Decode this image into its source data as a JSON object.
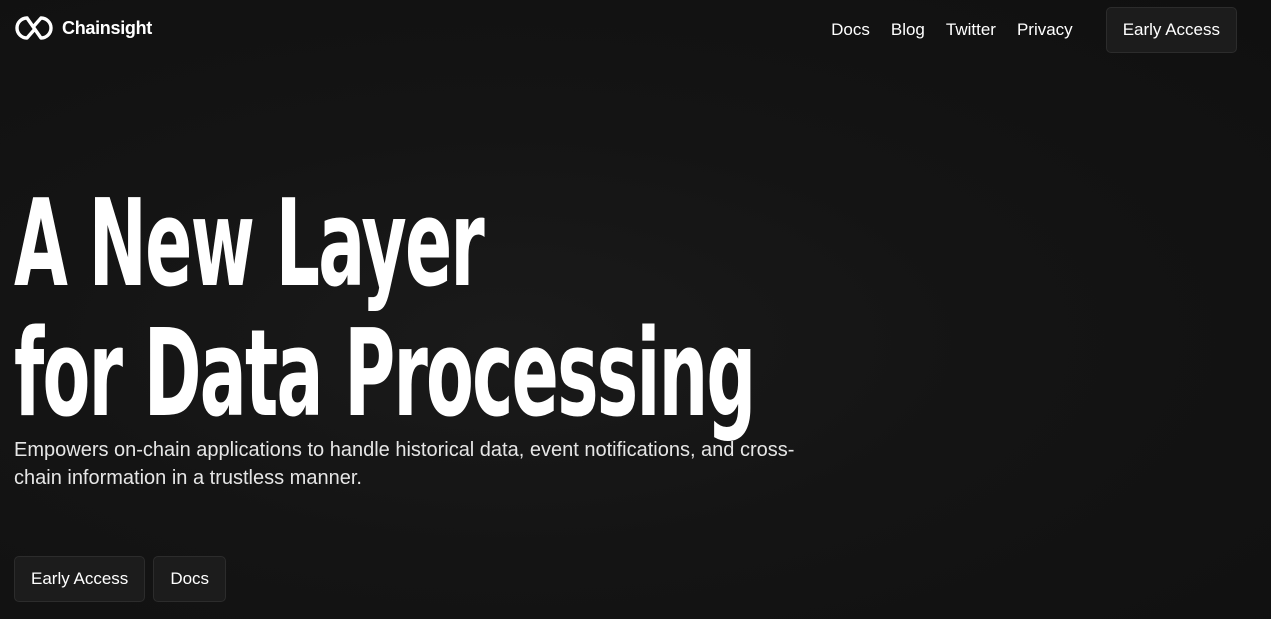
{
  "brand": {
    "name": "Chainsight",
    "logo_icon": "interlocked-rings-icon"
  },
  "nav": {
    "links": [
      "Docs",
      "Blog",
      "Twitter",
      "Privacy"
    ],
    "cta_label": "Early Access"
  },
  "hero": {
    "title_line1": "A New Layer",
    "title_line2": "for Data Processing",
    "subtitle": "Empowers on-chain applications to handle historical data, event notifications, and cross-chain information in a trustless manner.",
    "primary_button": "Early Access",
    "secondary_button": "Docs"
  },
  "colors": {
    "background": "#121212",
    "text": "#ffffff",
    "button_bg": "#1c1c1c",
    "button_border": "#2c2c2c"
  }
}
